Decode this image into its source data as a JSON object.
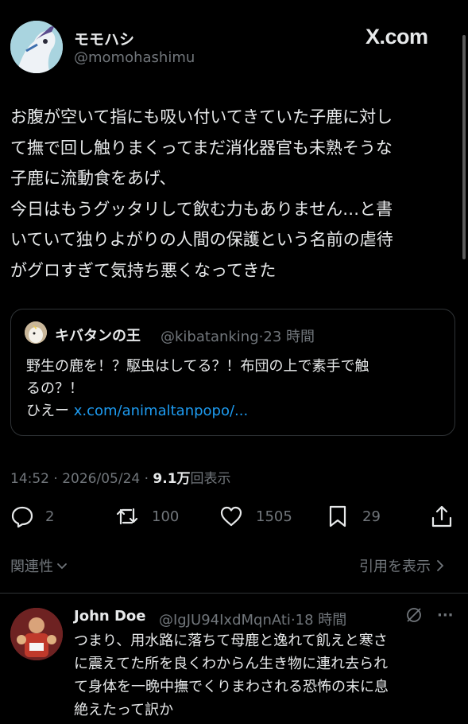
{
  "tweet": {
    "display_name": "モモハシ",
    "handle": "@momohashimu",
    "body": "お腹が空いて指にも吸い付いてきていた子鹿に対し\nて撫で回し触りまくってまだ消化器官も未熟そうな\n子鹿に流動食をあげ、\n今日はもうグッタリして飲む力もありません…と書\nいていて独りよがりの人間の保護という名前の虐待\nがグロすぎて気持ち悪くなってきた",
    "time": "14:52",
    "sep": "·",
    "date": "2026/05/24",
    "views_count": "9.1万",
    "views_label": "回表示"
  },
  "brand": {
    "logo": "X.com"
  },
  "quote": {
    "display_name": "キバタンの王",
    "handle": "@kibatanking",
    "sep": "·",
    "time_ago": "23 時間",
    "body": "野生の鹿を！？駆虫はしてる？！布団の上で素手で触\nるの？！\nひえー ",
    "link": "x.com/animaltanpopo/..."
  },
  "actions": {
    "replies": "2",
    "retweets": "100",
    "likes": "1505",
    "bookmarks": "29"
  },
  "icons": [
    "reply-icon",
    "retweet-icon",
    "like-icon",
    "bookmark-icon",
    "share-icon",
    "chevron-down-icon",
    "chevron-right-icon",
    "grok-icon",
    "more-icon"
  ],
  "sort": {
    "label": "関連性"
  },
  "view_quotes": {
    "label": "引用を表示"
  },
  "reply": {
    "display_name": "John Doe",
    "handle": "@IgJU94IxdMqnAti",
    "sep": "·",
    "time_ago": "18 時間",
    "body": "つまり、用水路に落ちて母鹿と逸れて飢えと寒さ\nに震えてた所を良くわからん生き物に連れ去られ\nて身体を一晩中撫でくりまわされる恐怖の末に息\n絶えたって訳か",
    "more": "···"
  },
  "colors": {
    "background": "#000000",
    "text": "#e7e9ea",
    "secondary": "#71767b",
    "link": "#1d9bf0",
    "border": "#2f3336"
  }
}
